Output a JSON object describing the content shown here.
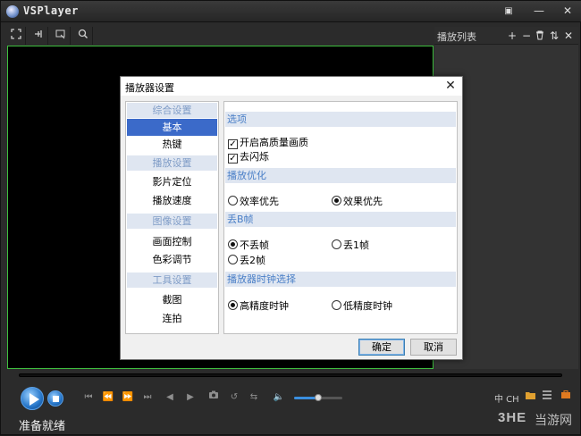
{
  "app": {
    "title": "VSPlayer"
  },
  "window_controls": {
    "menu_icon": "▣",
    "minimize_icon": "—",
    "close_icon": "✕"
  },
  "toolbar": {
    "icons": [
      "fullscreen-icon",
      "pin-icon",
      "snapshot-window-icon",
      "zoom-icon"
    ]
  },
  "playlist": {
    "title": "播放列表",
    "add": "+",
    "remove": "−",
    "delete": "🗑",
    "sort": "⇅",
    "close": "✕"
  },
  "controls": {
    "volume_level": 0.5,
    "lang_label": "中 CH"
  },
  "status": {
    "text": "准备就绪"
  },
  "watermark": {
    "text": "3HE",
    "text2": "当游网"
  },
  "dialog": {
    "title": "播放器设置",
    "close": "✕",
    "nav": {
      "group1": "综合设置",
      "basic": "基本",
      "hotkeys": "热键",
      "group2": "播放设置",
      "seek": "影片定位",
      "speed": "播放速度",
      "group3": "图像设置",
      "picture": "画面控制",
      "color": "色彩调节",
      "group4": "工具设置",
      "screenshot": "截图",
      "burst": "连拍"
    },
    "panel": {
      "options_title": "选项",
      "hq_label": "开启高质量画质",
      "hq_checked": true,
      "deflicker_label": "去闪烁",
      "deflicker_checked": true,
      "optimize_title": "播放优化",
      "efficiency_label": "效率优先",
      "quality_label": "效果优先",
      "optimize_selected": "quality",
      "drop_title": "丢B帧",
      "no_drop_label": "不丢帧",
      "drop1_label": "丢1帧",
      "drop2_label": "丢2帧",
      "drop_selected": "none",
      "clock_title": "播放器时钟选择",
      "high_clock_label": "高精度时钟",
      "low_clock_label": "低精度时钟",
      "clock_selected": "high"
    },
    "ok": "确定",
    "cancel": "取消"
  }
}
